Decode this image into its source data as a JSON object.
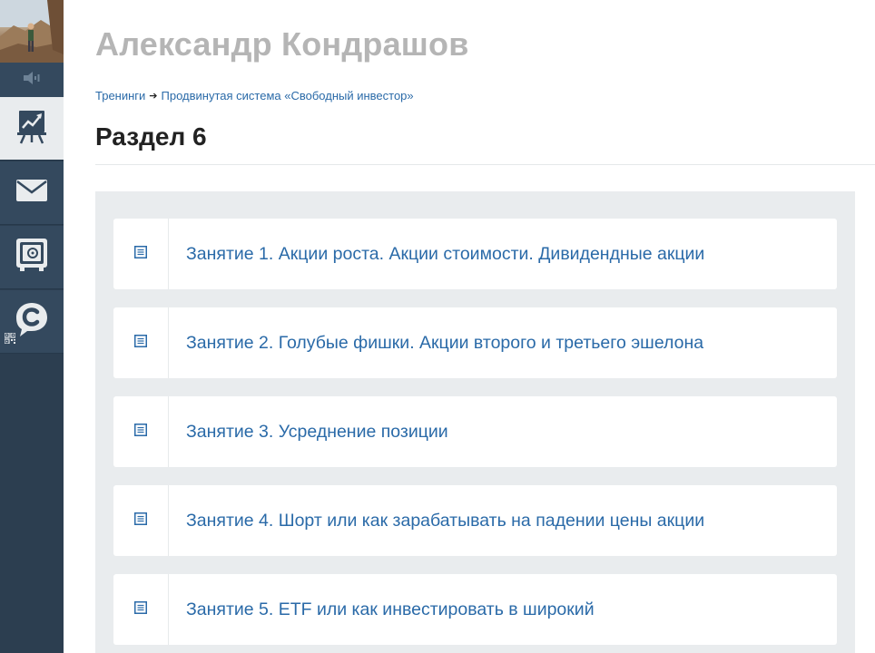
{
  "sidebar": {
    "avatar_icon": "user-photo",
    "sound_icon": "speaker-icon",
    "items": [
      {
        "name": "training",
        "icon": "chart-easel-icon",
        "active": true
      },
      {
        "name": "mail",
        "icon": "envelope-icon",
        "active": false
      },
      {
        "name": "safe",
        "icon": "safe-icon",
        "active": false
      },
      {
        "name": "chat",
        "icon": "chat-c-icon",
        "active": false
      }
    ],
    "qr_icon": "qr-code-icon"
  },
  "header": {
    "owner_name": "Александр Кондрашов"
  },
  "breadcrumb": {
    "items": [
      "Тренинги",
      "Продвинутая система «Свободный инвестор»"
    ]
  },
  "section": {
    "title": "Раздел 6"
  },
  "lessons": [
    {
      "title": "Занятие 1. Акции роста. Акции стоимости. Дивидендные акции",
      "icon": "document-icon"
    },
    {
      "title": "Занятие 2. Голубые фишки. Акции второго и третьего эшелона",
      "icon": "document-icon"
    },
    {
      "title": "Занятие 3. Усреднение позиции",
      "icon": "document-icon"
    },
    {
      "title": "Занятие 4. Шорт или как зарабатывать на падении цены акции",
      "icon": "document-icon"
    },
    {
      "title": "Занятие 5. ETF или как инвестировать в широкий",
      "icon": "document-icon"
    }
  ],
  "colors": {
    "sidebar": "#2c3e50",
    "link": "#2a6aa8",
    "panel": "#e9ecee",
    "owner_name": "#b5b5b5"
  }
}
